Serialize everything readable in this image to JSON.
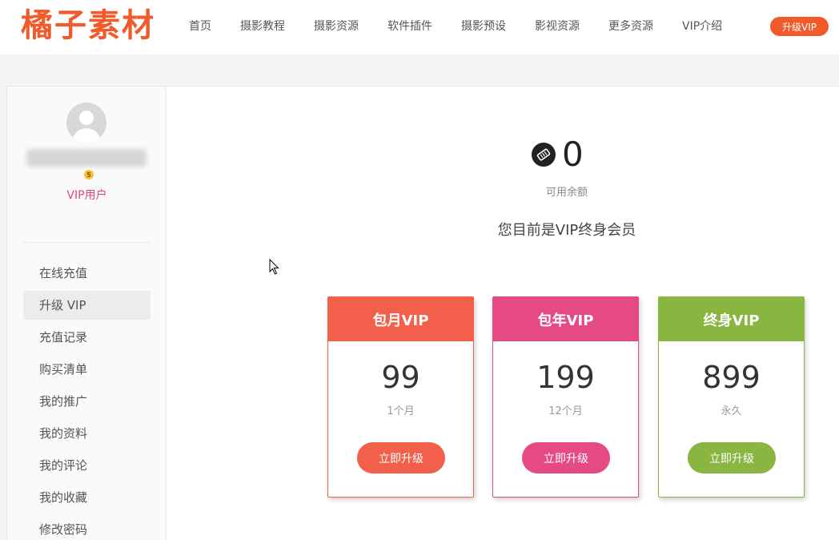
{
  "header": {
    "logo": "橘子素材",
    "nav": [
      "首页",
      "摄影教程",
      "摄影资源",
      "软件插件",
      "摄影预设",
      "影视资源",
      "更多资源",
      "VIP介绍"
    ],
    "upgrade_button": "升级VIP"
  },
  "sidebar": {
    "vip_badge": "5",
    "user_level": "VIP用户",
    "menu": [
      "在线充值",
      "升级 VIP",
      "充值记录",
      "购买清单",
      "我的推广",
      "我的资料",
      "我的评论",
      "我的收藏",
      "修改密码"
    ],
    "active_menu": "升级 VIP"
  },
  "main": {
    "balance_value": "0",
    "balance_label": "可用余额",
    "member_status": "您目前是VIP终身会员"
  },
  "plans": [
    {
      "name": "包月VIP",
      "price": "99",
      "period": "1个月",
      "button": "立即升级",
      "color": "#f25f4a"
    },
    {
      "name": "包年VIP",
      "price": "199",
      "period": "12个月",
      "button": "立即升级",
      "color": "#e54a84"
    },
    {
      "name": "终身VIP",
      "price": "899",
      "period": "永久",
      "button": "立即升级",
      "color": "#88b640"
    }
  ]
}
